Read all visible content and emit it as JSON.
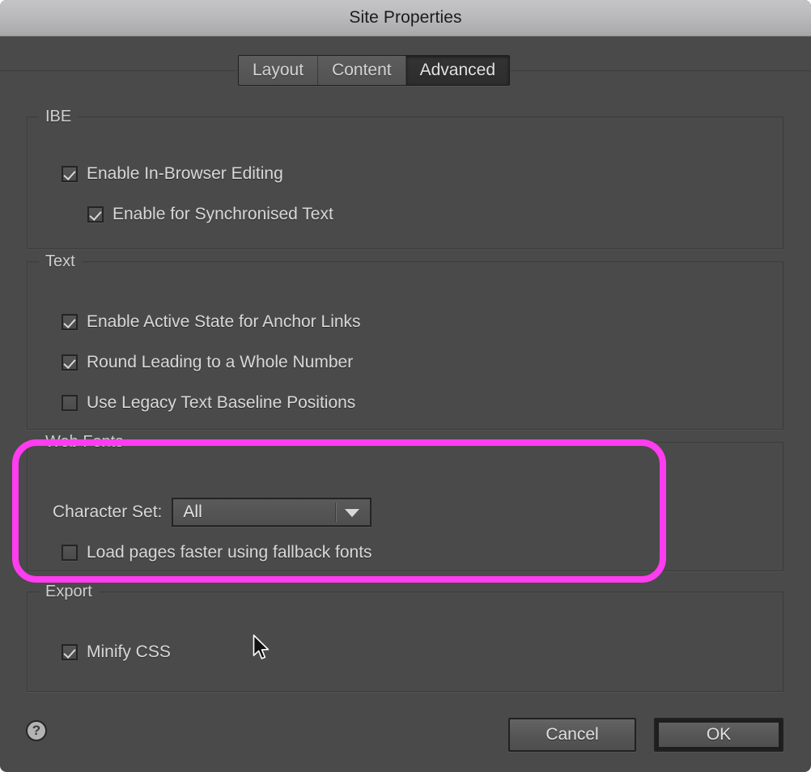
{
  "window": {
    "title": "Site Properties"
  },
  "tabs": [
    {
      "label": "Layout",
      "active": false
    },
    {
      "label": "Content",
      "active": false
    },
    {
      "label": "Advanced",
      "active": true
    }
  ],
  "sections": {
    "ibe": {
      "legend": "IBE",
      "options": [
        {
          "label": "Enable In-Browser Editing",
          "checked": true
        },
        {
          "label": "Enable for Synchronised Text",
          "checked": true
        }
      ]
    },
    "text": {
      "legend": "Text",
      "options": [
        {
          "label": "Enable Active State for Anchor Links",
          "checked": true
        },
        {
          "label": "Round Leading to a Whole Number",
          "checked": true
        },
        {
          "label": "Use Legacy Text Baseline Positions",
          "checked": false
        }
      ]
    },
    "web_fonts": {
      "legend": "Web Fonts",
      "character_set": {
        "label": "Character Set:",
        "value": "All",
        "arrow_icon": "chevron-down-icon"
      },
      "options": [
        {
          "label": "Load pages faster using fallback fonts",
          "checked": false
        }
      ]
    },
    "export": {
      "legend": "Export",
      "options": [
        {
          "label": "Minify CSS",
          "checked": true
        }
      ]
    }
  },
  "footer": {
    "help_icon": "help-icon",
    "help_glyph": "?",
    "cancel_label": "Cancel",
    "ok_label": "OK"
  },
  "annotation": {
    "highlight_color": "#ff3cf0",
    "target": "web-fonts-section"
  },
  "cursor": {
    "icon": "arrow-cursor"
  },
  "colors": {
    "dialog_background": "#4a4a4a",
    "titlebar_top": "#c4c4c6",
    "titlebar_bottom": "#a6a6a8",
    "text_primary": "#d8d8d8",
    "active_tab": "#2d2d2d",
    "highlight": "#ff3cf0"
  }
}
